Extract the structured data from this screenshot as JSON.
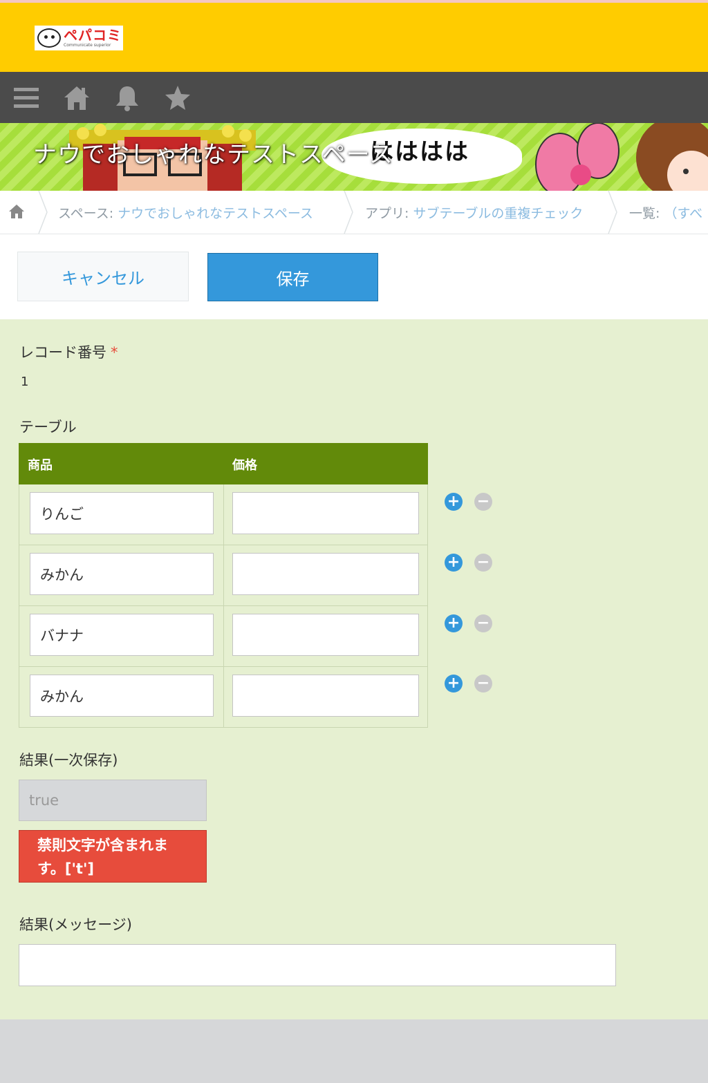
{
  "header": {
    "logo_text": "ペパコミ",
    "logo_subtext": "Communicate superior"
  },
  "toolbar": {
    "icons": [
      "menu-icon",
      "home-icon",
      "bell-icon",
      "star-icon"
    ]
  },
  "banner": {
    "title": "ナウでおしゃれなテストスペース",
    "bubble_text": "はははは"
  },
  "breadcrumb": {
    "space_key": "スペース: ",
    "space_value": "ナウでおしゃれなテストスペース",
    "app_key": "アプリ: ",
    "app_value": "サブテーブルの重複チェック",
    "view_key": "一覧: ",
    "view_value": "（すべ"
  },
  "actions": {
    "cancel_label": "キャンセル",
    "save_label": "保存"
  },
  "form": {
    "record_number_label": "レコード番号",
    "required_mark": "*",
    "record_number_value": "1",
    "table_label": "テーブル",
    "columns": [
      "商品",
      "価格"
    ],
    "rows": [
      {
        "product": "りんご",
        "price": ""
      },
      {
        "product": "みかん",
        "price": ""
      },
      {
        "product": "バナナ",
        "price": ""
      },
      {
        "product": "みかん",
        "price": ""
      }
    ],
    "result_label": "結果(一次保存)",
    "result_value": "true",
    "error_line1": "禁則文字が含まれま",
    "error_line2": "す。['t']",
    "message_label": "結果(メッセージ)",
    "message_value": ""
  },
  "colors": {
    "header": "#ffcc00",
    "toolbar": "#4b4b4b",
    "primary": "#3498db",
    "table_header": "#628a0a",
    "form_bg": "#e6f0d1",
    "error": "#e74c3c"
  }
}
